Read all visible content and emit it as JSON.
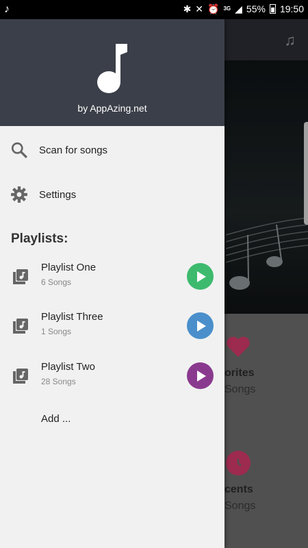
{
  "status_bar": {
    "battery": "55%",
    "time": "19:50",
    "network": "3G"
  },
  "background": {
    "tiles": [
      {
        "title": "orites",
        "subtitle": "Songs",
        "color": "#d23a6a",
        "icon": "heart-icon"
      },
      {
        "title": "cents",
        "subtitle": "Songs",
        "color": "#d23a6a",
        "icon": "clock-icon"
      }
    ]
  },
  "drawer": {
    "byline": "by AppAzing.net",
    "menu": [
      {
        "label": "Scan for songs",
        "icon": "search-icon"
      },
      {
        "label": "Settings",
        "icon": "gear-icon"
      }
    ],
    "playlists_title": "Playlists:",
    "playlists": [
      {
        "name": "Playlist One",
        "count": "6 Songs",
        "color": "#3dba6e"
      },
      {
        "name": "Playlist Three",
        "count": "1 Songs",
        "color": "#4a8fcb"
      },
      {
        "name": "Playlist Two",
        "count": "28 Songs",
        "color": "#8a3a8e"
      }
    ],
    "add_label": "Add ...",
    "colors": {
      "header_bg": "#3b3f49",
      "drawer_bg": "#f1f1f1"
    }
  }
}
